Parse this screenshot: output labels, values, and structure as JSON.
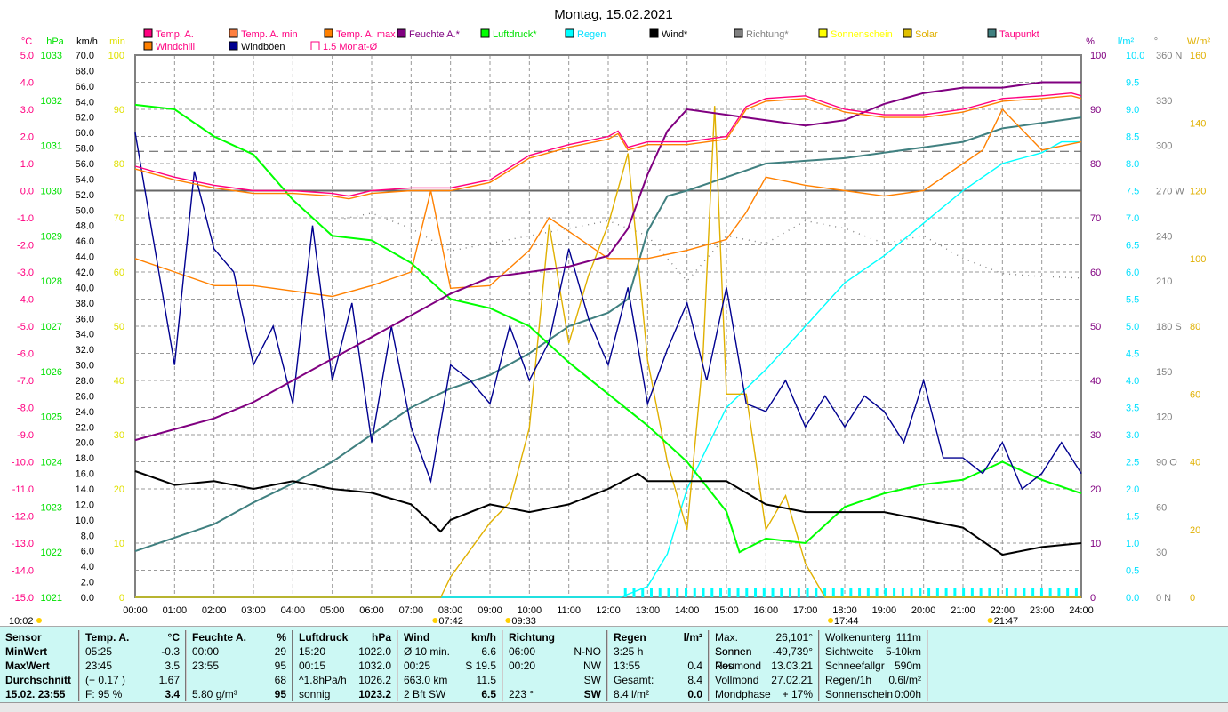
{
  "chart_data": {
    "type": "line",
    "title": "Montag, 15.02.2021",
    "legend": [
      {
        "name": "Temp. A.",
        "color": "#ff0080",
        "text": "#ff0080"
      },
      {
        "name": "Temp. A. min",
        "color": "#ff8040",
        "text": "#ff0080"
      },
      {
        "name": "Temp. A. max",
        "color": "#ff8000",
        "text": "#ff0080"
      },
      {
        "name": "Feuchte A.*",
        "color": "#800080",
        "text": "#800080"
      },
      {
        "name": "Luftdruck*",
        "color": "#00ff00",
        "text": "#00e000"
      },
      {
        "name": "Regen",
        "color": "#00ffff",
        "text": "#00e0ff"
      },
      {
        "name": "Wind*",
        "color": "#000000",
        "text": "#000000"
      },
      {
        "name": "Richtung*",
        "color": "#808080",
        "text": "#808080"
      },
      {
        "name": "Sonnenschein",
        "color": "#ffff00",
        "text": "#ffff00"
      },
      {
        "name": "Solar",
        "color": "#e0c000",
        "text": "#e0b000"
      },
      {
        "name": "Taupunkt",
        "color": "#408080",
        "text": "#ff0080"
      },
      {
        "name": "Windchill",
        "color": "#ff8000",
        "text": "#ff0080"
      },
      {
        "name": "Windböen",
        "color": "#000090",
        "text": "#000000"
      },
      {
        "name": "1.5 Monat-Ø",
        "color": "#ff0080",
        "text": "#ff0080"
      }
    ],
    "axes": {
      "left": [
        {
          "unit": "°C",
          "color": "#ff0080",
          "range": [
            -15,
            5
          ],
          "step": 1,
          "decimals": 1
        },
        {
          "unit": "hPa",
          "color": "#00e000",
          "range": [
            1021,
            1033
          ],
          "step": 1,
          "decimals": 0
        },
        {
          "unit": "km/h",
          "color": "#000000",
          "range": [
            0,
            70
          ],
          "step": 2,
          "decimals": 1
        },
        {
          "unit": "min",
          "color": "#e0e000",
          "range": [
            0,
            100
          ],
          "step": 10,
          "decimals": 0
        }
      ],
      "right": [
        {
          "unit": "%",
          "color": "#800080",
          "range": [
            0,
            100
          ],
          "step": 10,
          "decimals": 0
        },
        {
          "unit": "l/m²",
          "color": "#00e0ff",
          "range": [
            0,
            10
          ],
          "step": 0.5,
          "decimals": 1
        },
        {
          "unit": "°",
          "color": "#808080",
          "range": [
            0,
            360
          ],
          "step": 30,
          "decimals": 0,
          "compass": {
            "0": "N",
            "90": "O",
            "180": "S",
            "270": "W",
            "360": "N"
          }
        },
        {
          "unit": "W/m²",
          "color": "#e0b000",
          "range": [
            0,
            160
          ],
          "step": 20,
          "decimals": 0
        }
      ]
    },
    "x_ticks": [
      "00:00",
      "01:00",
      "02:00",
      "03:00",
      "04:00",
      "05:00",
      "06:00",
      "07:00",
      "08:00",
      "09:00",
      "10:00",
      "11:00",
      "12:00",
      "13:00",
      "14:00",
      "15:00",
      "16:00",
      "17:00",
      "18:00",
      "19:00",
      "20:00",
      "21:00",
      "22:00",
      "23:00",
      "24:00"
    ],
    "xlim": [
      0,
      24
    ],
    "markers": [
      {
        "label": "10:02",
        "x": -3.3
      },
      {
        "label": "07:42",
        "x": 7.7
      },
      {
        "label": "09:33",
        "x": 9.55
      },
      {
        "label": "17:44",
        "x": 17.73
      },
      {
        "label": "21:47",
        "x": 21.78
      }
    ],
    "reference_lines": [
      {
        "name": "1.5 Monat-Ø",
        "axis": 0,
        "value": 1.45,
        "dash": true
      },
      {
        "name": "zero",
        "axis": 0,
        "value": 0,
        "dash": false
      }
    ],
    "series": [
      {
        "name": "Taupunkt",
        "axis": "left0",
        "color": "#408080",
        "x": [
          0,
          1,
          2,
          3,
          4,
          5,
          6,
          7,
          8,
          9,
          10,
          11,
          12,
          12.5,
          13,
          13.5,
          14,
          15,
          16,
          17,
          18,
          19,
          20,
          21,
          22,
          23,
          24
        ],
        "y": [
          -13.3,
          -12.8,
          -12.3,
          -11.5,
          -10.8,
          -10,
          -9,
          -8,
          -7.3,
          -6.8,
          -6,
          -5,
          -4.5,
          -4,
          -1.5,
          -0.2,
          0,
          0.5,
          1,
          1.1,
          1.2,
          1.4,
          1.6,
          1.8,
          2.3,
          2.5,
          2.7
        ]
      },
      {
        "name": "Regen",
        "axis": "right1",
        "color": "#00ffff",
        "x": [
          0,
          12.3,
          13,
          13.5,
          14,
          15,
          16,
          17,
          18,
          19,
          20,
          21,
          22,
          23,
          23.5,
          24
        ],
        "y": [
          0,
          0,
          0.2,
          0.8,
          2,
          3.5,
          4.2,
          5,
          5.8,
          6.3,
          6.9,
          7.5,
          8,
          8.2,
          8.4,
          8.4
        ]
      },
      {
        "name": "Richtung*",
        "axis": "right2",
        "color": "#808080",
        "dotted": true,
        "x": [
          5,
          6,
          7,
          8,
          9,
          10,
          11,
          12,
          13,
          14,
          15,
          16,
          17,
          18,
          19,
          20,
          21,
          22,
          23,
          24
        ],
        "y": [
          250,
          255,
          245,
          230,
          235,
          240,
          245,
          250,
          240,
          210,
          240,
          235,
          250,
          245,
          235,
          240,
          225,
          215,
          213,
          212
        ]
      },
      {
        "name": "Solar",
        "axis": "right3",
        "color": "#e0b000",
        "x": [
          0,
          7.75,
          8,
          9,
          9.5,
          10,
          10.5,
          11,
          11.5,
          12,
          12.5,
          13,
          13.5,
          14,
          14.4,
          14.7,
          15,
          15.5,
          16,
          16.5,
          17,
          17.5,
          24
        ],
        "y": [
          0,
          0,
          6,
          22,
          28,
          50,
          110,
          75,
          95,
          110,
          131,
          70,
          40,
          20,
          70,
          145,
          60,
          60,
          20,
          30,
          10,
          0,
          0
        ]
      },
      {
        "name": "Luftdruck*",
        "axis": "left1",
        "color": "#00ff00",
        "x": [
          0,
          1,
          2,
          3,
          4,
          5,
          6,
          7,
          8,
          9,
          10,
          11,
          12,
          13,
          14,
          15,
          15.33,
          16,
          17,
          18,
          19,
          20,
          21,
          22,
          23,
          24
        ],
        "y": [
          1031.9,
          1031.8,
          1031.2,
          1030.8,
          1029.8,
          1029,
          1028.9,
          1028.4,
          1027.6,
          1027.4,
          1027,
          1026.2,
          1025.5,
          1024.8,
          1024,
          1022.9,
          1022,
          1022.3,
          1022.2,
          1023,
          1023.3,
          1023.5,
          1023.6,
          1024,
          1023.6,
          1023.3
        ]
      },
      {
        "name": "Windchill",
        "axis": "left0",
        "color": "#ff8000",
        "x": [
          0,
          1,
          2,
          3,
          4,
          5,
          6,
          7,
          7.5,
          8,
          9,
          10,
          10.5,
          11,
          12,
          13,
          14,
          15,
          15.5,
          16,
          17,
          18,
          19,
          20,
          21,
          21.5,
          22,
          23,
          24
        ],
        "y": [
          -2.5,
          -3,
          -3.5,
          -3.5,
          -3.7,
          -3.9,
          -3.5,
          -3,
          0,
          -3.6,
          -3.5,
          -2.2,
          -1,
          -1.5,
          -2.5,
          -2.5,
          -2.2,
          -1.8,
          -0.8,
          0.5,
          0.2,
          0,
          -0.2,
          0,
          1,
          1.5,
          3,
          1.5,
          1.8
        ]
      },
      {
        "name": "Windböen",
        "axis": "left2",
        "color": "#000090",
        "x": [
          0,
          0.5,
          1,
          1.5,
          2,
          2.5,
          3,
          3.5,
          4,
          4.5,
          5,
          5.5,
          6,
          6.5,
          7,
          7.5,
          8,
          8.5,
          9,
          9.5,
          10,
          10.5,
          11,
          11.5,
          12,
          12.5,
          13,
          13.5,
          14,
          14.5,
          15,
          15.5,
          16,
          16.5,
          17,
          17.5,
          18,
          18.5,
          19,
          19.5,
          20,
          20.5,
          21,
          21.5,
          22,
          22.5,
          23,
          23.5,
          24
        ],
        "y": [
          60,
          45,
          30,
          55,
          45,
          42,
          30,
          35,
          25,
          48,
          28,
          38,
          20,
          35,
          22,
          15,
          30,
          28,
          25,
          35,
          28,
          33,
          45,
          36,
          30,
          40,
          25,
          32,
          38,
          28,
          40,
          25,
          24,
          28,
          22,
          26,
          22,
          26,
          24,
          20,
          28,
          18,
          18,
          16,
          20,
          14,
          16,
          20,
          16
        ]
      },
      {
        "name": "Feuchte A.*",
        "axis": "right0",
        "color": "#800080",
        "x": [
          0,
          1,
          2,
          3,
          4,
          5,
          6,
          7,
          8,
          9,
          10,
          11,
          12,
          12.5,
          13,
          13.5,
          14,
          15,
          16,
          17,
          18,
          19,
          20,
          21,
          22,
          23,
          24
        ],
        "y": [
          29,
          31,
          33,
          36,
          40,
          44,
          48,
          52,
          56,
          59,
          60,
          61,
          63,
          68,
          78,
          86,
          90,
          89,
          88,
          87,
          88,
          91,
          93,
          94,
          94,
          95,
          95
        ]
      },
      {
        "name": "Wind*",
        "axis": "left2",
        "color": "#000000",
        "x": [
          0,
          1,
          2,
          3,
          4,
          5,
          6,
          7,
          7.75,
          8,
          9,
          10,
          11,
          12,
          12.75,
          13,
          14,
          15,
          16,
          17,
          18,
          19,
          20,
          21,
          22,
          23,
          24
        ],
        "y": [
          16.3,
          14.5,
          15,
          14,
          15,
          14,
          13.5,
          12,
          8.5,
          10,
          12,
          11,
          12,
          14,
          16,
          15,
          15,
          15,
          12,
          11,
          11,
          11,
          10,
          9,
          5.5,
          6.5,
          7
        ]
      },
      {
        "name": "Temp. A. max",
        "axis": "left0",
        "color": "#ff8000",
        "x": [
          0,
          1,
          2,
          3,
          4,
          5,
          5.42,
          6,
          7,
          8,
          9,
          10,
          11,
          12,
          12.25,
          12.5,
          13,
          14,
          15,
          15.5,
          16,
          17,
          18,
          19,
          20,
          21,
          21.75,
          22,
          23,
          23.75,
          24
        ],
        "y": [
          0.8,
          0.4,
          0.1,
          -0.1,
          -0.1,
          -0.2,
          -0.3,
          -0.1,
          0,
          0,
          0.3,
          1.2,
          1.6,
          1.9,
          2.1,
          1.5,
          1.7,
          1.7,
          1.9,
          3,
          3.3,
          3.4,
          2.9,
          2.7,
          2.7,
          2.9,
          3.2,
          3.3,
          3.4,
          3.5,
          3.4
        ]
      },
      {
        "name": "Temp. A.",
        "axis": "left0",
        "color": "#ff0080",
        "x": [
          0,
          1,
          2,
          3,
          4,
          5,
          5.42,
          6,
          7,
          8,
          9,
          10,
          11,
          12,
          12.25,
          12.5,
          13,
          14,
          15,
          15.5,
          16,
          17,
          18,
          19,
          20,
          21,
          21.75,
          22,
          23,
          23.75,
          24
        ],
        "y": [
          0.9,
          0.5,
          0.2,
          0,
          0,
          -0.1,
          -0.2,
          0,
          0.1,
          0.1,
          0.4,
          1.3,
          1.7,
          2,
          2.2,
          1.6,
          1.8,
          1.8,
          2,
          3.1,
          3.4,
          3.5,
          3,
          2.8,
          2.8,
          3,
          3.3,
          3.4,
          3.5,
          3.6,
          3.5
        ]
      }
    ]
  },
  "table": {
    "cols": [
      {
        "rows": [
          [
            "Sensor",
            ""
          ],
          [
            "MinWert",
            ""
          ],
          [
            "MaxWert",
            ""
          ],
          [
            "Durchschnitt",
            ""
          ],
          [
            "15.02. 23:55",
            ""
          ]
        ],
        "bold_rows": [
          0,
          1,
          2,
          3,
          4
        ]
      },
      {
        "rows": [
          [
            "Temp. A.",
            "°C"
          ],
          [
            "05:25",
            "-0.3"
          ],
          [
            "23:45",
            "3.5"
          ],
          [
            "(+ 0.17 )",
            "1.67"
          ],
          [
            "F: 95 %",
            "3.4"
          ]
        ],
        "bold_rows": [
          0
        ]
      },
      {
        "rows": [
          [
            "Feuchte A.",
            "%"
          ],
          [
            "00:00",
            "29"
          ],
          [
            "23:55",
            "95"
          ],
          [
            "",
            "68"
          ],
          [
            "5.80 g/m³",
            "95"
          ]
        ],
        "bold_rows": [
          0
        ]
      },
      {
        "rows": [
          [
            "Luftdruck",
            "hPa"
          ],
          [
            "15:20",
            "1022.0"
          ],
          [
            "00:15",
            "1032.0"
          ],
          [
            "^1.8hPa/h",
            "1026.2"
          ],
          [
            "sonnig",
            "1023.2"
          ]
        ],
        "bold_rows": [
          0
        ]
      },
      {
        "rows": [
          [
            "Wind",
            "km/h"
          ],
          [
            "Ø 10 min.",
            "6.6"
          ],
          [
            "00:25",
            "S 19.5"
          ],
          [
            "663.0 km",
            "11.5"
          ],
          [
            "2 Bft SW",
            "6.5"
          ]
        ],
        "bold_rows": [
          0
        ]
      },
      {
        "rows": [
          [
            "Richtung",
            ""
          ],
          [
            "06:00",
            "N-NO"
          ],
          [
            "00:20",
            "NW"
          ],
          [
            "",
            "SW"
          ],
          [
            "223 °",
            "SW"
          ]
        ],
        "bold_rows": [
          0
        ]
      },
      {
        "rows": [
          [
            "Regen",
            "l/m²"
          ],
          [
            "3:25 h",
            ""
          ],
          [
            "13:55",
            "0.4"
          ],
          [
            "Gesamt:",
            "8.4"
          ],
          [
            "8.4 l/m²",
            "0.0"
          ]
        ],
        "bold_rows": [
          0
        ]
      },
      {
        "rows": [
          [
            "Max. Sonnen",
            "26,101°"
          ],
          [
            "Sonnen Pos",
            "-49,739°"
          ],
          [
            "Neumond",
            "13.03.21"
          ],
          [
            "Vollmond",
            "27.02.21"
          ],
          [
            "Mondphase",
            "+ 17%"
          ]
        ],
        "bold_rows": []
      },
      {
        "rows": [
          [
            "Wolkenunterg",
            "111m"
          ],
          [
            "Sichtweite",
            "5-10km"
          ],
          [
            "Schneefallgr",
            "590m"
          ],
          [
            "Regen/1h",
            "0.6l/m²"
          ],
          [
            "Sonnenschein",
            "0:00h"
          ]
        ],
        "bold_rows": []
      }
    ]
  }
}
